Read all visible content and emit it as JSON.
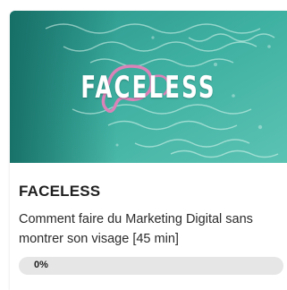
{
  "course": {
    "thumbnail_text": "FACELESS",
    "title": "FACELESS",
    "description": "Comment faire du Marketing Digital sans montrer son visage [45 min]",
    "progress_label": "0%",
    "progress_value": 0
  },
  "colors": {
    "water_light": "#3fb1a2",
    "water_dark": "#1f7c74",
    "mask": "#d983b8",
    "progress_track": "#e6e6e6",
    "title_text": "#1f1f1f"
  },
  "icons": {
    "thumbnail": "pool-water-with-pink-mask-image"
  }
}
